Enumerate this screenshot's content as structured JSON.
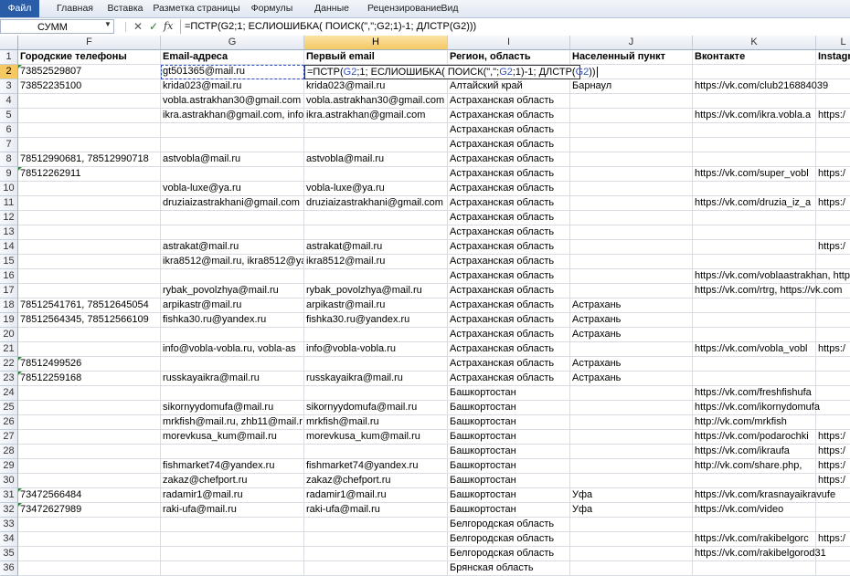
{
  "ribbon": {
    "tabs": [
      "Файл",
      "Главная",
      "Вставка",
      "Разметка страницы",
      "Формулы",
      "Данные",
      "Рецензирование",
      "Вид"
    ]
  },
  "formula_bar": {
    "name_box": "СУММ",
    "formula": "=ПСТР(G2;1; ЕСЛИОШИБКА( ПОИСК(\",\";G2;1)-1; ДЛСТР(G2)))"
  },
  "columns": [
    "F",
    "G",
    "H",
    "I",
    "J",
    "K",
    "L"
  ],
  "editing_cell": {
    "parts": [
      "=ПСТР(",
      "G2",
      ";1; ЕСЛИОШИБКА( ПОИСК(\",\";",
      "G2",
      ";1)-1; ДЛСТР(",
      "G2",
      "))"
    ]
  },
  "rows": [
    {
      "n": "1",
      "F": "Городские телефоны",
      "G": "Email-адреса",
      "H": "Первый email",
      "I": "Регион, область",
      "J": "Населенный пункт",
      "K": "Вконтакте",
      "L": "Instagra"
    },
    {
      "n": "2",
      "F": "73852529807",
      "G": "gt501365@mail.ru",
      "H": "",
      "I": "",
      "J": "",
      "K": "",
      "L": ""
    },
    {
      "n": "3",
      "F": "73852235100",
      "G": "krida023@mail.ru",
      "H": "krida023@mail.ru",
      "I": "Алтайский край",
      "J": "Барнаул",
      "K": "https://vk.com/club216884039",
      "L": ""
    },
    {
      "n": "4",
      "F": "",
      "G": "vobla.astrakhan30@gmail.com",
      "H": "vobla.astrakhan30@gmail.com",
      "I": "Астраханская область",
      "J": "",
      "K": "",
      "L": ""
    },
    {
      "n": "5",
      "F": "",
      "G": "ikra.astrakhan@gmail.com, info",
      "H": "ikra.astrakhan@gmail.com",
      "I": "Астраханская область",
      "J": "",
      "K": "https://vk.com/ikra.vobla.a",
      "L": "https:/"
    },
    {
      "n": "6",
      "F": "",
      "G": "",
      "H": "",
      "I": "Астраханская область",
      "J": "",
      "K": "",
      "L": ""
    },
    {
      "n": "7",
      "F": "",
      "G": "",
      "H": "",
      "I": "Астраханская область",
      "J": "",
      "K": "",
      "L": ""
    },
    {
      "n": "8",
      "F": "78512990681, 78512990718",
      "G": "astvobla@mail.ru",
      "H": "astvobla@mail.ru",
      "I": "Астраханская область",
      "J": "",
      "K": "",
      "L": ""
    },
    {
      "n": "9",
      "F": "78512262911",
      "G": "",
      "H": "",
      "I": "Астраханская область",
      "J": "",
      "K": "https://vk.com/super_vobl",
      "L": "https:/"
    },
    {
      "n": "10",
      "F": "",
      "G": "vobla-luxe@ya.ru",
      "H": "vobla-luxe@ya.ru",
      "I": "Астраханская область",
      "J": "",
      "K": "",
      "L": ""
    },
    {
      "n": "11",
      "F": "",
      "G": "druziaizastrakhani@gmail.com",
      "H": "druziaizastrakhani@gmail.com",
      "I": "Астраханская область",
      "J": "",
      "K": "https://vk.com/druzia_iz_a",
      "L": "https:/"
    },
    {
      "n": "12",
      "F": "",
      "G": "",
      "H": "",
      "I": "Астраханская область",
      "J": "",
      "K": "",
      "L": ""
    },
    {
      "n": "13",
      "F": "",
      "G": "",
      "H": "",
      "I": "Астраханская область",
      "J": "",
      "K": "",
      "L": ""
    },
    {
      "n": "14",
      "F": "",
      "G": "astrakat@mail.ru",
      "H": "astrakat@mail.ru",
      "I": "Астраханская область",
      "J": "",
      "K": "",
      "L": "https:/"
    },
    {
      "n": "15",
      "F": "",
      "G": "ikra8512@mail.ru, ikra8512@ya",
      "H": "ikra8512@mail.ru",
      "I": "Астраханская область",
      "J": "",
      "K": "",
      "L": ""
    },
    {
      "n": "16",
      "F": "",
      "G": "",
      "H": "",
      "I": "Астраханская область",
      "J": "",
      "K": "https://vk.com/voblaastrakhan, https:/",
      "L": ""
    },
    {
      "n": "17",
      "F": "",
      "G": "rybak_povolzhya@mail.ru",
      "H": "rybak_povolzhya@mail.ru",
      "I": "Астраханская область",
      "J": "",
      "K": "https://vk.com/rtrg, https://vk.com",
      "L": ""
    },
    {
      "n": "18",
      "F": "78512541761, 78512645054",
      "G": "arpikastr@mail.ru",
      "H": "arpikastr@mail.ru",
      "I": "Астраханская область",
      "J": "Астрахань",
      "K": "",
      "L": ""
    },
    {
      "n": "19",
      "F": "78512564345, 78512566109",
      "G": "fishka30.ru@yandex.ru",
      "H": "fishka30.ru@yandex.ru",
      "I": "Астраханская область",
      "J": "Астрахань",
      "K": "",
      "L": ""
    },
    {
      "n": "20",
      "F": "",
      "G": "",
      "H": "",
      "I": "Астраханская область",
      "J": "Астрахань",
      "K": "",
      "L": ""
    },
    {
      "n": "21",
      "F": "",
      "G": "info@vobla-vobla.ru, vobla-as",
      "H": "info@vobla-vobla.ru",
      "I": "Астраханская область",
      "J": "",
      "K": "https://vk.com/vobla_vobl",
      "L": "https:/"
    },
    {
      "n": "22",
      "F": "78512499526",
      "G": "",
      "H": "",
      "I": "Астраханская область",
      "J": "Астрахань",
      "K": "",
      "L": ""
    },
    {
      "n": "23",
      "F": "78512259168",
      "G": "russkayaikra@mail.ru",
      "H": "russkayaikra@mail.ru",
      "I": "Астраханская область",
      "J": "Астрахань",
      "K": "",
      "L": ""
    },
    {
      "n": "24",
      "F": "",
      "G": "",
      "H": "",
      "I": "Башкортостан",
      "J": "",
      "K": "https://vk.com/freshfishufa",
      "L": ""
    },
    {
      "n": "25",
      "F": "",
      "G": "sikornyydomufa@mail.ru",
      "H": "sikornyydomufa@mail.ru",
      "I": "Башкортостан",
      "J": "",
      "K": "https://vk.com/ikornydomufa",
      "L": ""
    },
    {
      "n": "26",
      "F": "",
      "G": "mrkfish@mail.ru, zhb11@mail.r",
      "H": "mrkfish@mail.ru",
      "I": "Башкортостан",
      "J": "",
      "K": "http://vk.com/mrkfish",
      "L": ""
    },
    {
      "n": "27",
      "F": "",
      "G": "morevkusa_kum@mail.ru",
      "H": "morevkusa_kum@mail.ru",
      "I": "Башкортостан",
      "J": "",
      "K": "https://vk.com/podarochki",
      "L": "https:/"
    },
    {
      "n": "28",
      "F": "",
      "G": "",
      "H": "",
      "I": "Башкортостан",
      "J": "",
      "K": "https://vk.com/ikraufa",
      "L": "https:/"
    },
    {
      "n": "29",
      "F": "",
      "G": "fishmarket74@yandex.ru",
      "H": "fishmarket74@yandex.ru",
      "I": "Башкортостан",
      "J": "",
      "K": "http://vk.com/share.php,",
      "L": "https:/"
    },
    {
      "n": "30",
      "F": "",
      "G": "zakaz@chefport.ru",
      "H": "zakaz@chefport.ru",
      "I": "Башкортостан",
      "J": "",
      "K": "",
      "L": "https:/"
    },
    {
      "n": "31",
      "F": "73472566484",
      "G": "radamir1@mail.ru",
      "H": "radamir1@mail.ru",
      "I": "Башкортостан",
      "J": "Уфа",
      "K": "https://vk.com/krasnayaikravufe",
      "L": ""
    },
    {
      "n": "32",
      "F": "73472627989",
      "G": "raki-ufa@mail.ru",
      "H": "raki-ufa@mail.ru",
      "I": "Башкортостан",
      "J": "Уфа",
      "K": "https://vk.com/video",
      "L": ""
    },
    {
      "n": "33",
      "F": "",
      "G": "",
      "H": "",
      "I": "Белгородская область",
      "J": "",
      "K": "",
      "L": ""
    },
    {
      "n": "34",
      "F": "",
      "G": "",
      "H": "",
      "I": "Белгородская область",
      "J": "",
      "K": "https://vk.com/rakibelgorc",
      "L": "https:/"
    },
    {
      "n": "35",
      "F": "",
      "G": "",
      "H": "",
      "I": "Белгородская область",
      "J": "",
      "K": "https://vk.com/rakibelgorod31",
      "L": ""
    },
    {
      "n": "36",
      "F": "",
      "G": "",
      "H": "",
      "I": "Брянская область",
      "J": "",
      "K": "",
      "L": ""
    }
  ]
}
